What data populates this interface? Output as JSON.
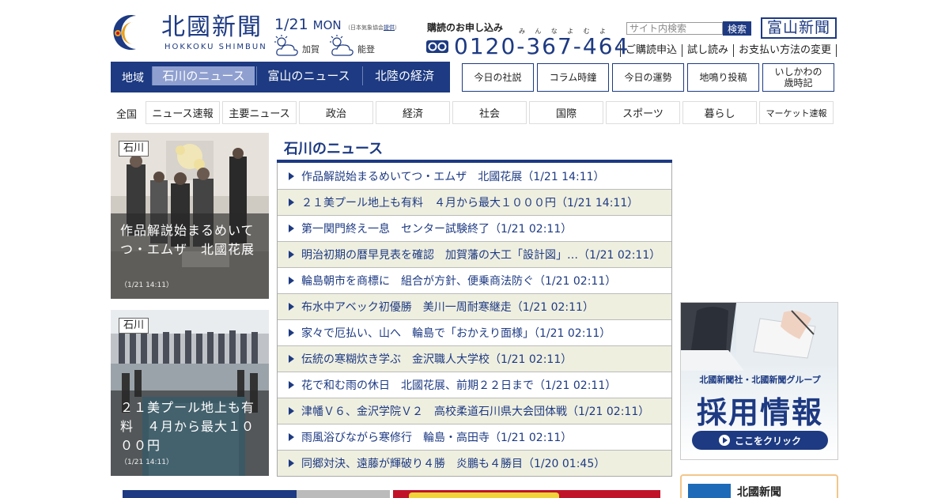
{
  "header": {
    "logo_jp": "北國新聞",
    "logo_en": "HOKKOKU SHIMBUN",
    "date": "1/21",
    "weekday": "MON",
    "weather_source": "（日本気象協会",
    "weather_source_link": "提供",
    "weather_source_end": "）",
    "weather": [
      {
        "region": "加賀",
        "icon": "sun-cloud-icon"
      },
      {
        "region": "能登",
        "icon": "sun-cloud-icon"
      }
    ],
    "subscribe_title": "購読のお申し込み",
    "subscribe_ruby": [
      "み",
      "ん",
      "な",
      "よ",
      "む",
      "よ"
    ],
    "phone_number": "0120-367-464",
    "search_placeholder": "サイト内検索",
    "search_button": "検索",
    "toyama_button": "富山新聞",
    "util_links": [
      "ご購読申込",
      "試し読み",
      "お支払い方法の変更"
    ]
  },
  "region_nav": {
    "label": "地域",
    "tabs": [
      {
        "label": "石川のニュース",
        "active": true
      },
      {
        "label": "富山のニュース",
        "active": false
      },
      {
        "label": "北陸の経済",
        "active": false
      }
    ]
  },
  "feature_buttons": [
    "今日の社説",
    "コラム時鐘",
    "今日の運勢",
    "地鳴り投稿",
    "いしかわの\n歳時記"
  ],
  "category_nav": {
    "label": "全国",
    "items": [
      "ニュース速報",
      "主要ニュース",
      "政治",
      "経済",
      "社会",
      "国際",
      "スポーツ",
      "暮らし",
      "マーケット速報"
    ]
  },
  "photo_cards": [
    {
      "tag": "石川",
      "title": "作品解説始まるめいてつ・エムザ　北國花展",
      "time": "（1/21 14:11）"
    },
    {
      "tag": "石川",
      "title": "２１美プール地上も有料　４月から最大１０００円",
      "time": "（1/21 14:11）"
    }
  ],
  "news": {
    "heading": "石川のニュース",
    "items": [
      "作品解説始まるめいてつ・エムザ　北國花展（1/21 14:11）",
      "２１美プール地上も有料　４月から最大１０００円（1/21 14:11）",
      "第一関門終え一息　センター試験終了（1/21 02:11）",
      "明治初期の暦早見表を確認　加賀藩の大工「設計図」…（1/21 02:11）",
      "輪島朝市を商標に　組合が方針、便乗商法防ぐ（1/21 02:11）",
      "布水中アベック初優勝　美川一周耐寒継走（1/21 02:11）",
      "家々で厄払い、山へ　輪島で「おかえり面様」（1/21 02:11）",
      "伝統の寒糊炊き学ぶ　金沢職人大学校（1/21 02:11）",
      "花で和む雨の休日　北國花展、前期２２日まで（1/21 02:11）",
      "津幡Ｖ６、金沢学院Ｖ２　高校柔道石川県大会団体戦（1/21 02:11）",
      "雨風浴びながら寒修行　輪島・高田寺（1/21 02:11）",
      "同郷対決、遠藤が輝破り４勝　炎鵬も４勝目（1/20 01:45）"
    ]
  },
  "recruit_banner": {
    "company": "北國新聞社・北國新聞グループ",
    "title": "採用情報",
    "button": "ここをクリック"
  },
  "paper_box": {
    "name": "北國新聞"
  },
  "colors": {
    "brand": "#1d3a82",
    "active_tab": "#8fa0d0",
    "row_alt": "#efefe0"
  }
}
